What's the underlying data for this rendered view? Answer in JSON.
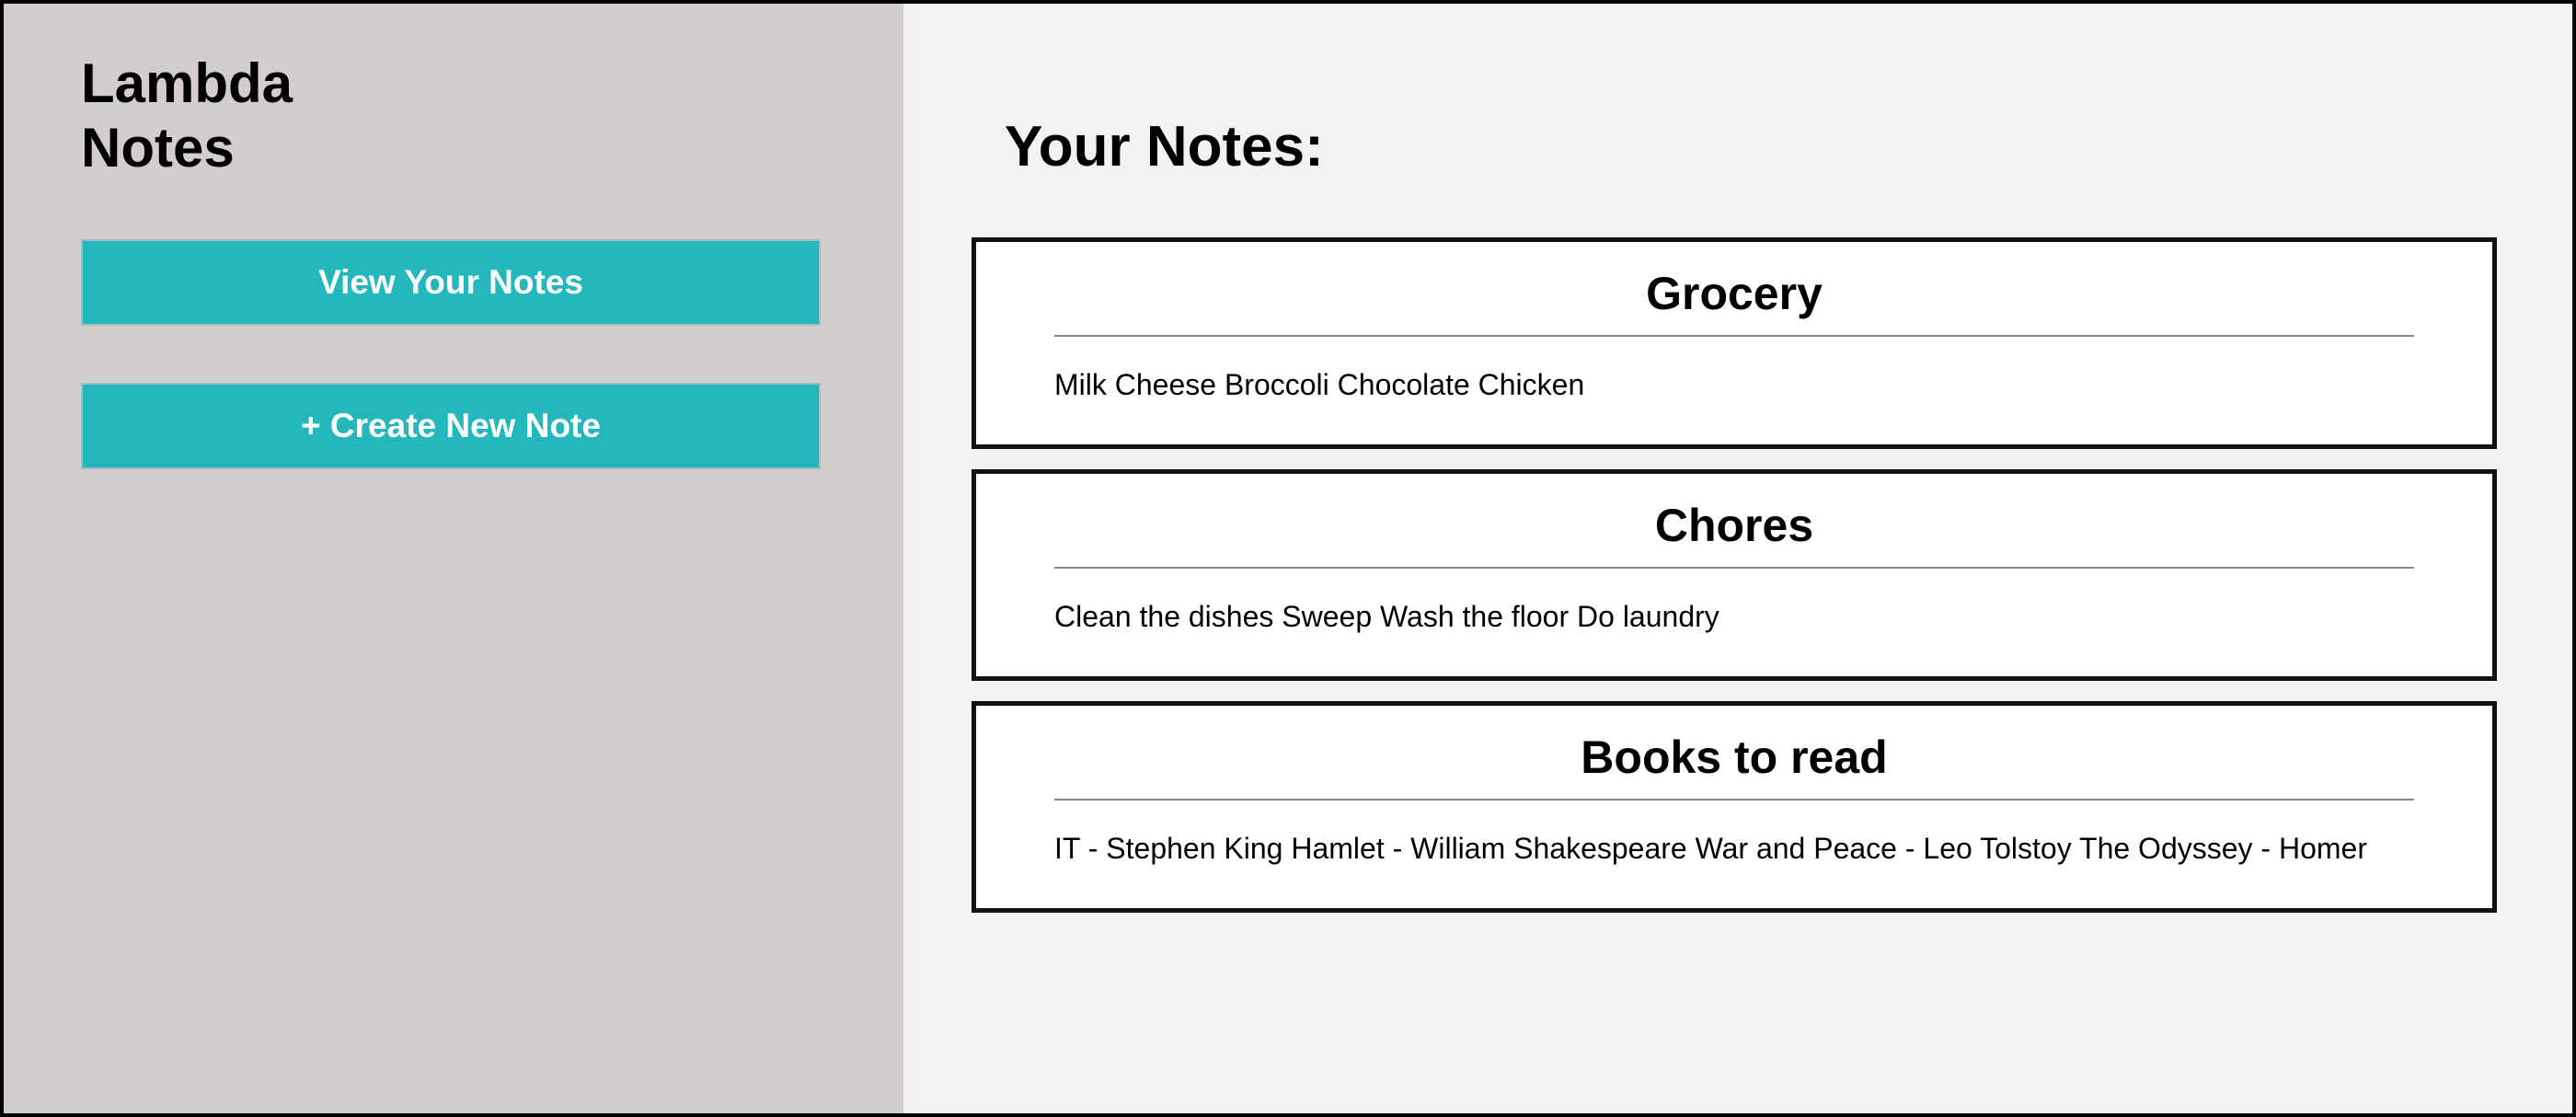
{
  "sidebar": {
    "app_title": "Lambda Notes",
    "buttons": [
      {
        "label": "View Your Notes"
      },
      {
        "label": "+ Create New Note"
      }
    ]
  },
  "main": {
    "heading": "Your Notes:",
    "notes": [
      {
        "title": "Grocery",
        "body": "Milk Cheese Broccoli Chocolate Chicken"
      },
      {
        "title": "Chores",
        "body": "Clean the dishes Sweep Wash the floor Do laundry"
      },
      {
        "title": "Books to read",
        "body": "IT - Stephen King Hamlet - William Shakespeare War and Peace - Leo Tolstoy The Odyssey - Homer"
      }
    ]
  },
  "colors": {
    "sidebar_bg": "#d3cdce",
    "main_bg": "#f3f1f2",
    "button_bg": "#24b8bc",
    "button_text": "#ffffff",
    "card_border": "#111111"
  }
}
